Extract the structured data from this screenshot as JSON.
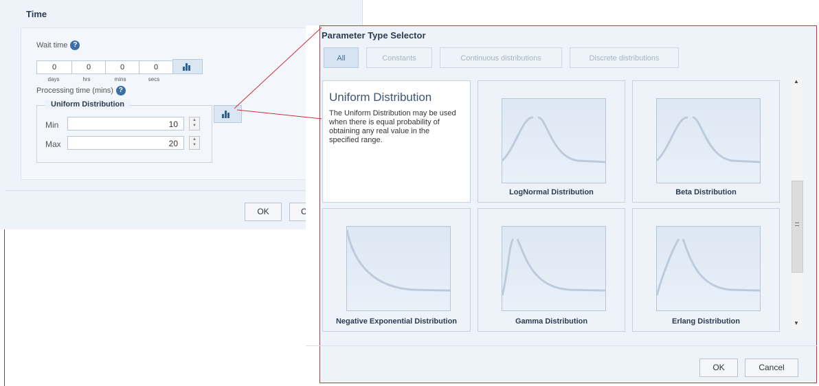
{
  "time_dialog": {
    "title": "Time",
    "wait_time_label": "Wait time",
    "help_glyph": "?",
    "wait_values": [
      "0",
      "0",
      "0",
      "0"
    ],
    "wait_units": [
      "days",
      "hrs",
      "mins",
      "secs"
    ],
    "processing_label": "Processing time (mins)",
    "group_title": "Uniform Distribution",
    "min_label": "Min",
    "min_value": "10",
    "max_label": "Max",
    "max_value": "20",
    "ok_label": "OK",
    "cancel_partial": "C"
  },
  "selector": {
    "title": "Parameter Type Selector",
    "tabs": [
      "All",
      "Constants",
      "Continuous distributions",
      "Discrete distributions"
    ],
    "uniform_card": {
      "heading": "Uniform Distribution",
      "description": "The Uniform Distribution may be used when there is equal probability of obtaining any real value in the specified range."
    },
    "cards": [
      "LogNormal Distribution",
      "Beta Distribution",
      "Negative Exponential Distribution",
      "Gamma Distribution",
      "Erlang Distribution"
    ],
    "ok_label": "OK",
    "cancel_label": "Cancel"
  },
  "icons": [
    "help-icon",
    "distribution-chart-icon",
    "spinner-icon",
    "scroll-up-icon",
    "scroll-down-icon",
    "scroll-grip-icon"
  ],
  "colors": {
    "accent": "#3d6fa6",
    "highlight": "#cc2f3a",
    "panel": "#eef3fa"
  }
}
